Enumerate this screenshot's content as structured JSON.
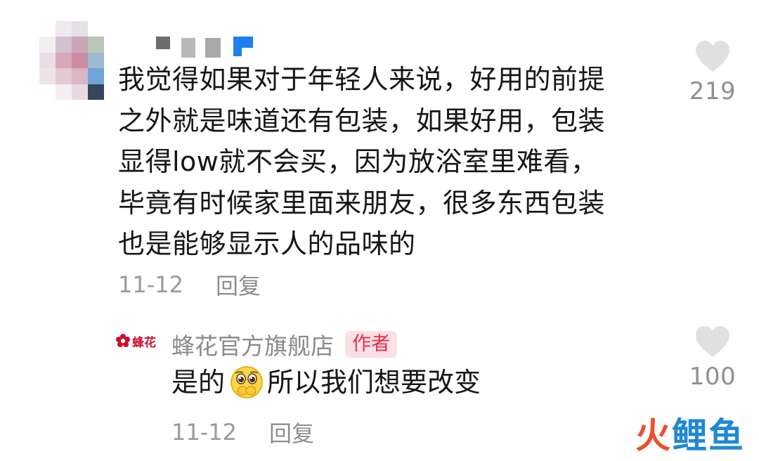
{
  "comment": {
    "avatar_icon": "blurred-avatar",
    "text_lines": [
      "我觉得如果对于年轻人来说，好用的前提",
      "之外就是味道还有包装，如果好用，包装",
      "显得low就不会买，因为放浴室里难看，",
      "毕竟有时候家里面来朋友，很多东西包装",
      "也是能够显示人的品味的"
    ],
    "date": "11-12",
    "reply_label": "回复",
    "like_icon": "heart-icon",
    "like_count": "219"
  },
  "reply": {
    "logo_text": "蜂花",
    "username": "蜂花官方旗舰店",
    "author_badge": "作者",
    "text_before_emoji": "是的",
    "emoji_icon": "pleading-face-covering-mouth-emoji",
    "text_after_emoji": "所以我们想要改变",
    "date": "11-12",
    "reply_label": "回复",
    "like_icon": "heart-icon",
    "like_count": "100"
  },
  "watermark": {
    "chars": [
      "火",
      "鲤",
      "鱼"
    ]
  },
  "colors": {
    "badge_bg": "#fbe0e5",
    "badge_text": "#e5304f",
    "meta_gray": "#9a9a9a",
    "heart_gray": "#e0e0e0",
    "logo_red": "#c8102e",
    "watermark_orange": "#ee4e2a",
    "watermark_blue": "#1e88d6"
  }
}
